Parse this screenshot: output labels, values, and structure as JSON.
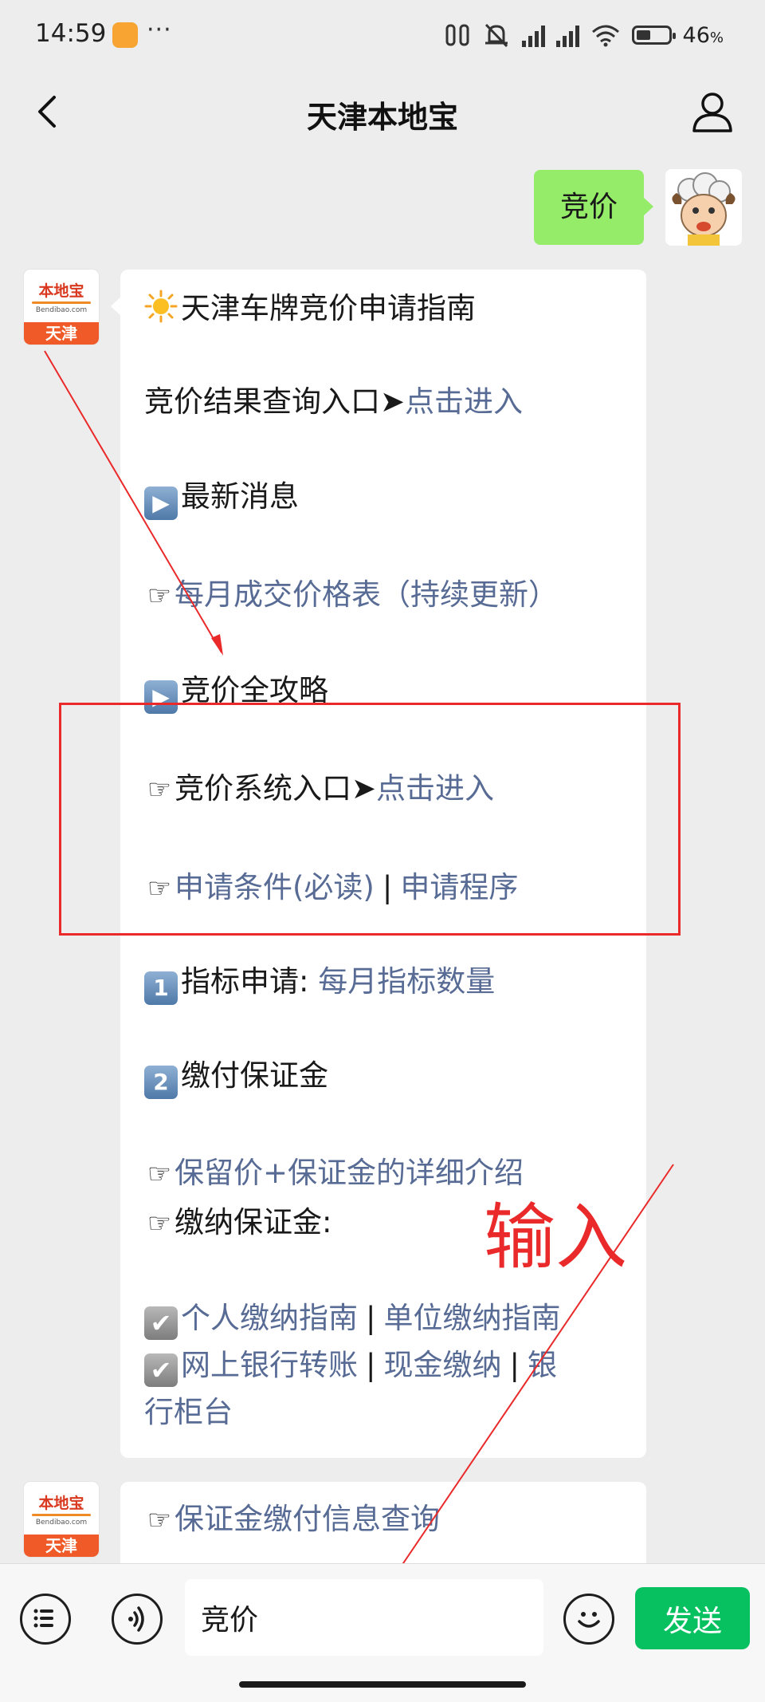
{
  "status_bar": {
    "time": "14:59",
    "dots": "···",
    "battery": "46",
    "battery_unit": "%",
    "battery_level": 0.46
  },
  "header": {
    "title": "天津本地宝"
  },
  "sent_message": {
    "text": "竞价"
  },
  "bot_avatar": {
    "logo": "本地宝",
    "domain": "Bendibao.com",
    "city": "天津"
  },
  "message1": {
    "title": "天津车牌竞价申请指南",
    "result_query": {
      "label": "竞价结果查询入口➤",
      "link": "点击进入"
    },
    "news_heading": "最新消息",
    "monthly_table_link": "每月成交价格表（持续更新）",
    "guide_heading": "竞价全攻略",
    "system_entry": {
      "label": "竞价系统入口➤",
      "link": "点击进入"
    },
    "conditions_link": "申请条件(必读)",
    "procedure_link": "申请程序",
    "separator": "|",
    "step1": {
      "badge": "1",
      "label": "指标申请:",
      "link": "每月指标数量"
    },
    "step2": {
      "badge": "2",
      "label": "缴付保证金"
    },
    "reserve_price_link": "保留价+保证金的详细介绍",
    "deposit_label": "缴纳保证金:",
    "personal_guide_link": "个人缴纳指南",
    "company_guide_link": "单位缴纳指南",
    "online_transfer_link": "网上银行转账",
    "cash_link": "现金缴纳",
    "bank_counter_link_part1": "银",
    "bank_counter_link_part2": "行柜台"
  },
  "message2": {
    "deposit_query_link": "保证金缴付信息查询"
  },
  "annotation": {
    "label": "输入",
    "color": "#ea2a2a"
  },
  "input_bar": {
    "value": "竞价",
    "send_label": "发送"
  },
  "colors": {
    "link": "#576b95",
    "sent_bubble": "#95ec69",
    "send_button": "#07c160"
  }
}
